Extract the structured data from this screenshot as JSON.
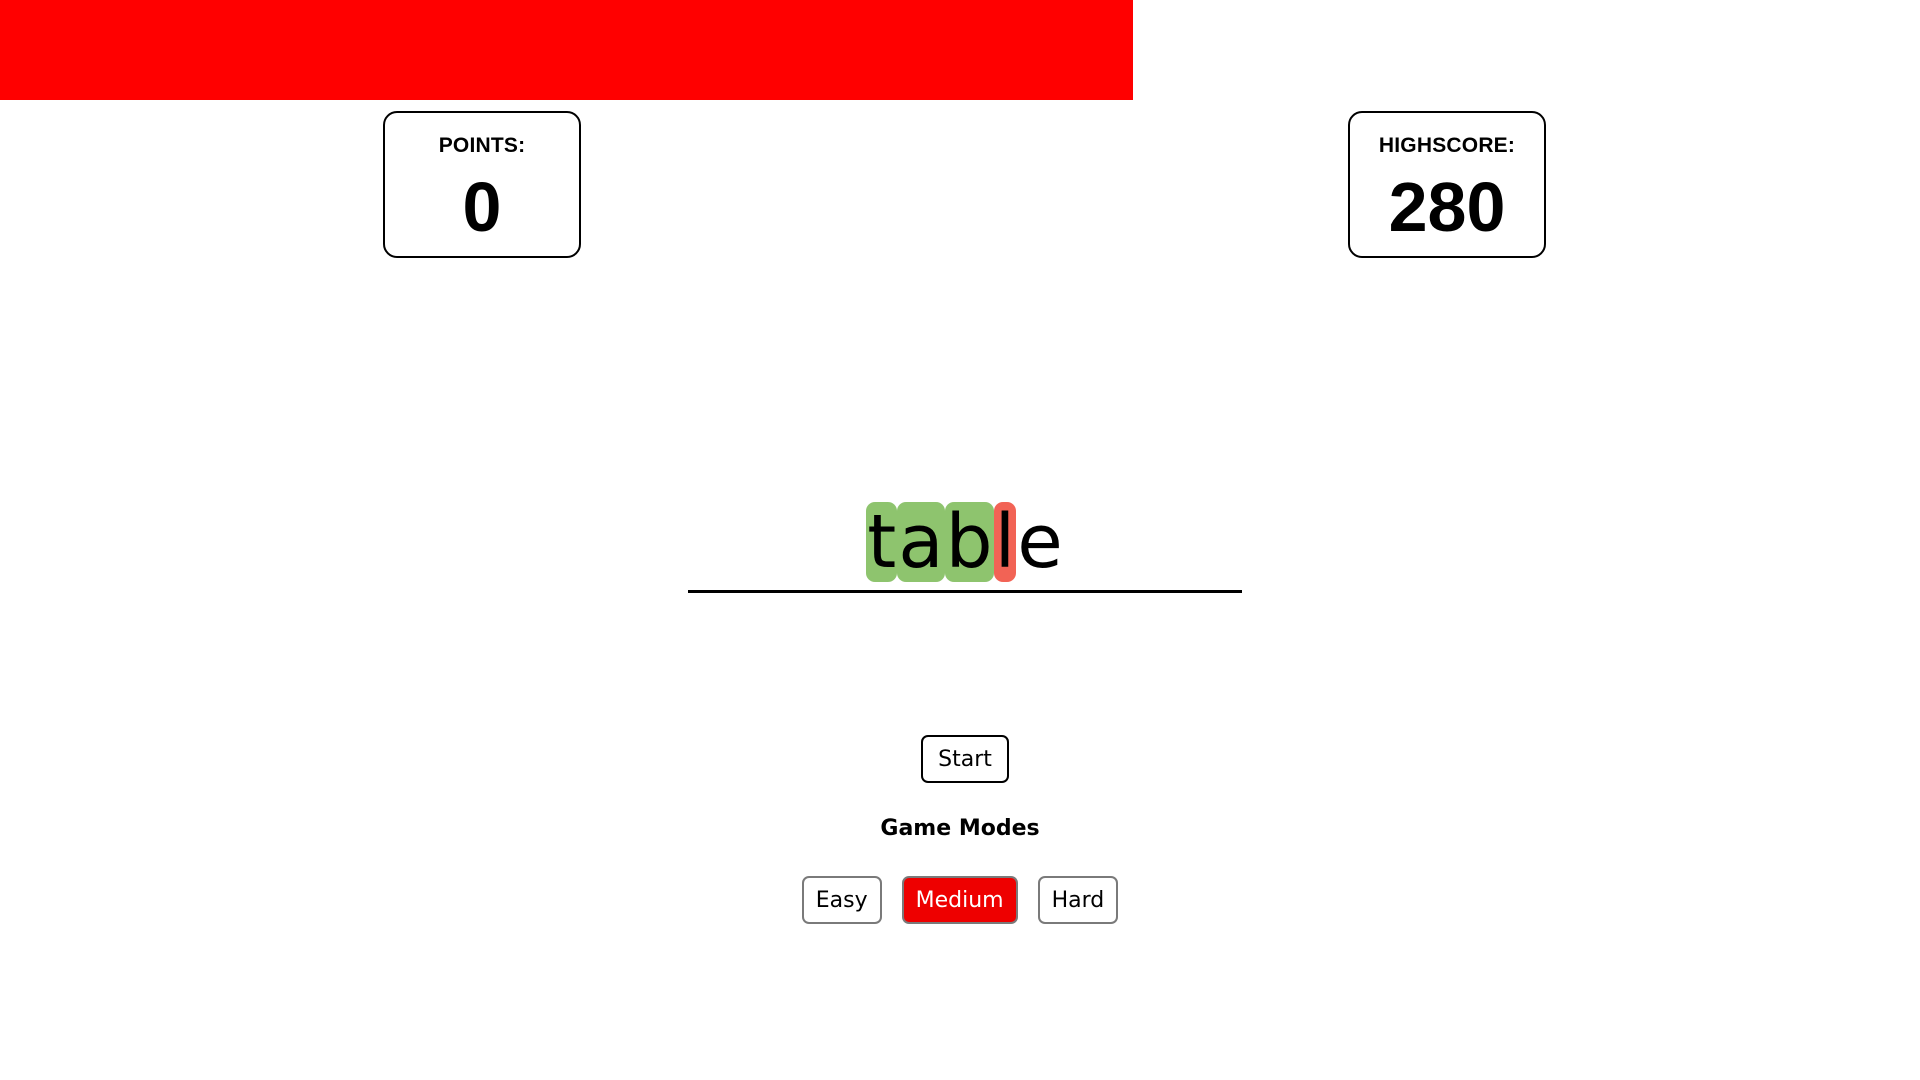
{
  "colors": {
    "accent": "#ff0000",
    "correct_letter": "#8ec46e",
    "wrong_letter": "#f26355",
    "active_mode": "#ee0000"
  },
  "timer": {
    "remaining_fraction": 0.59
  },
  "points": {
    "label": "POINTS:",
    "value": "0"
  },
  "highscore": {
    "label": "HIGHSCORE:",
    "value": "280"
  },
  "word": {
    "letters": [
      {
        "char": "t",
        "state": "correct"
      },
      {
        "char": "a",
        "state": "correct"
      },
      {
        "char": "b",
        "state": "correct"
      },
      {
        "char": "l",
        "state": "wrong"
      },
      {
        "char": "e",
        "state": "pending"
      }
    ]
  },
  "controls": {
    "start_label": "Start"
  },
  "modes": {
    "heading": "Game Modes",
    "options": [
      {
        "label": "Easy",
        "active": false
      },
      {
        "label": "Medium",
        "active": true
      },
      {
        "label": "Hard",
        "active": false
      }
    ]
  }
}
